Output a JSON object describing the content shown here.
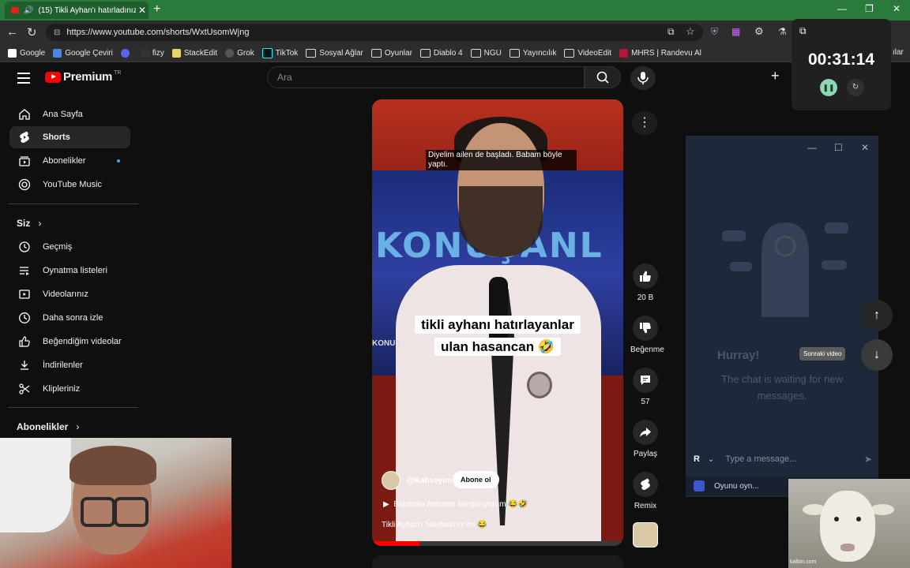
{
  "browser": {
    "tab_title": "(15) Tikli Ayhan'ı hatırladınız",
    "url": "https://www.youtube.com/shorts/WxtUsomWjng",
    "bookmarks": [
      "Google",
      "Google Çeviri",
      "fizy",
      "StackEdit",
      "Grok",
      "TikTok",
      "Sosyal Ağlar",
      "Oyunlar",
      "Diablo 4",
      "NGU",
      "Yayıncılık",
      "VideoEdit",
      "MHRS | Randevu Al"
    ],
    "bookmarks_overflow": "ılar"
  },
  "header": {
    "logo_text": "Premium",
    "logo_region": "TR",
    "search_placeholder": "Ara"
  },
  "sidebar": {
    "items": [
      {
        "label": "Ana Sayfa",
        "icon": "home-icon"
      },
      {
        "label": "Shorts",
        "icon": "shorts-icon"
      },
      {
        "label": "Abonelikler",
        "icon": "subscriptions-icon"
      },
      {
        "label": "YouTube Music",
        "icon": "music-icon"
      }
    ],
    "siz_heading": "Siz",
    "siz_items": [
      {
        "label": "Geçmiş"
      },
      {
        "label": "Oynatma listeleri"
      },
      {
        "label": "Videolarınız"
      },
      {
        "label": "Daha sonra izle"
      },
      {
        "label": "Beğendiğim videolar"
      },
      {
        "label": "İndirilenler"
      },
      {
        "label": "Klipleriniz"
      }
    ],
    "subs_heading": "Abonelikler"
  },
  "short": {
    "subtitle": "Diyelim ailen de başladı. Babam böyle yaptı.",
    "caption": "tikli ayhanı hatırlayanlar ulan hasancan 🤣",
    "watermark": "KONUŞ",
    "neon_text": "KONUŞANL",
    "channel": "@Kahveyim",
    "subscribe_label": "Abone ol",
    "song": "Babamla Amcamı karıştırıyorum 😂🤣",
    "description": "Tikli Ayhan'ı hatırladınız mı 😂",
    "progress": 0.19
  },
  "actions": {
    "likes": "20 B",
    "dislike_label": "Beğenme",
    "comments": "57",
    "share_label": "Paylaş",
    "remix_label": "Remix"
  },
  "nav": {
    "tooltip": "Sonraki video"
  },
  "chat": {
    "title": "Hurray!",
    "waiting": "The chat is waiting for new messages.",
    "input_placeholder": "Type a message...",
    "user_initial": "R",
    "footer_text": "Oyunu oyn..."
  },
  "timer": {
    "time": "00:31:14"
  },
  "sheep_watermark": "kalbin.com"
}
